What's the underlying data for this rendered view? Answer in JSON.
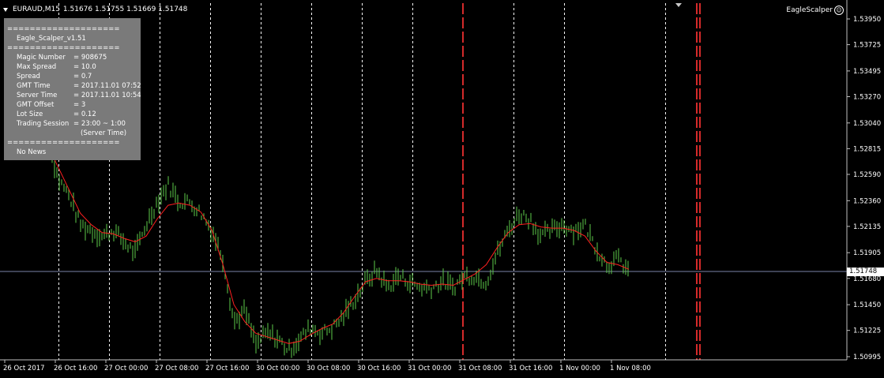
{
  "header": {
    "symbol": "EURAUD,M15",
    "ohlc": "1.51676 1.51755 1.51669 1.51748"
  },
  "ea_name": "EagleScalper",
  "ea_icon": "smiley-icon",
  "info_panel": {
    "separator": "====================",
    "title": "Eagle_Scalper_v1.51",
    "rows": [
      {
        "key": "Magic Number",
        "value": "= 908675"
      },
      {
        "key": "Max Spread",
        "value": "= 10.0"
      },
      {
        "key": "Spread",
        "value": "= 0.7"
      },
      {
        "key": "GMT Time",
        "value": "= 2017.11.01 07:52"
      },
      {
        "key": "Server Time",
        "value": "= 2017.11.01 10:54"
      },
      {
        "key": "GMT Offset",
        "value": "= 3"
      },
      {
        "key": "Lot Size",
        "value": "= 0.12"
      },
      {
        "key": "Trading Session",
        "value": "= 23:00 ~ 1:00"
      }
    ],
    "session_note": "(Server Time)",
    "news": "No News"
  },
  "current_price": "1.51748",
  "colors": {
    "background": "#000000",
    "bars": "#5ecb4a",
    "moving_average": "#ff2020",
    "grid": "#ffffff",
    "price_line": "#7a85a8",
    "session_line": "#d42a2a",
    "panel": "#7a7a7a"
  },
  "chart_data": {
    "type": "line",
    "title": "EURAUD,M15",
    "y_ticks": [
      "1.53950",
      "1.53725",
      "1.53495",
      "1.53270",
      "1.53040",
      "1.52815",
      "1.52590",
      "1.52360",
      "1.52135",
      "1.51905",
      "1.51680",
      "1.51450",
      "1.51225",
      "1.50995"
    ],
    "x_ticks": [
      "26 Oct 2017",
      "26 Oct 16:00",
      "27 Oct 00:00",
      "27 Oct 08:00",
      "27 Oct 16:00",
      "30 Oct 00:00",
      "30 Oct 08:00",
      "30 Oct 16:00",
      "31 Oct 00:00",
      "31 Oct 08:00",
      "31 Oct 16:00",
      "1 Nov 00:00",
      "1 Nov 08:00"
    ],
    "ylim": [
      1.50995,
      1.5395
    ],
    "current_price": 1.51748,
    "series": [
      {
        "name": "",
        "type": "bars",
        "values": [
          1.529,
          1.5255,
          1.524,
          1.5215,
          1.521,
          1.5205,
          1.521,
          1.52,
          1.519,
          1.5215,
          1.5235,
          1.525,
          1.5235,
          1.5235,
          1.5225,
          1.521,
          1.5185,
          1.513,
          1.514,
          1.511,
          1.512,
          1.5115,
          1.5105,
          1.5115,
          1.5125,
          1.512,
          1.5125,
          1.5135,
          1.515,
          1.5165,
          1.5175,
          1.516,
          1.517,
          1.5165,
          1.516,
          1.516,
          1.5165,
          1.516,
          1.517,
          1.517,
          1.5165,
          1.519,
          1.521,
          1.5225,
          1.522,
          1.5205,
          1.521,
          1.5215,
          1.521,
          1.5215,
          1.5195,
          1.518,
          1.5185,
          1.5175
        ]
      },
      {
        "name": "",
        "type": "moving_average",
        "values": [
          1.5285,
          1.5265,
          1.5245,
          1.5225,
          1.5215,
          1.5208,
          1.5207,
          1.5203,
          1.52,
          1.5205,
          1.522,
          1.5232,
          1.5234,
          1.5232,
          1.5226,
          1.521,
          1.518,
          1.5145,
          1.513,
          1.512,
          1.5117,
          1.5114,
          1.5111,
          1.5113,
          1.5119,
          1.5124,
          1.5128,
          1.5138,
          1.5152,
          1.5165,
          1.5168,
          1.5166,
          1.5166,
          1.5165,
          1.5163,
          1.5162,
          1.5163,
          1.5162,
          1.5167,
          1.5172,
          1.518,
          1.5195,
          1.5208,
          1.5215,
          1.5216,
          1.5213,
          1.5212,
          1.5212,
          1.521,
          1.5205,
          1.5192,
          1.5182,
          1.518,
          1.5176
        ]
      }
    ],
    "vertical_grid_lines": [
      "26 Oct 16:00",
      "27 Oct 00:00",
      "27 Oct 08:00",
      "27 Oct 16:00",
      "30 Oct 00:00",
      "30 Oct 08:00",
      "30 Oct 16:00",
      "31 Oct 00:00",
      "31 Oct 16:00",
      "1 Nov 00:00",
      "1 Nov 16:00"
    ],
    "session_lines": [
      "31 Oct 08:00",
      "1 Nov 21:00"
    ],
    "grid": true
  }
}
